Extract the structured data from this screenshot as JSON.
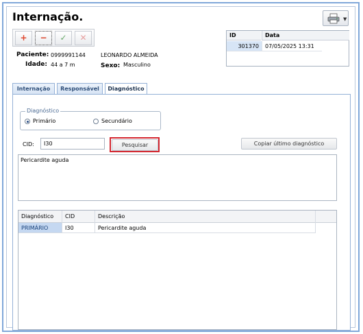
{
  "window": {
    "title": "Internação."
  },
  "toolbar": {
    "add_symbol": "+",
    "remove_symbol": "−",
    "confirm_symbol": "✓",
    "cancel_symbol": "✕"
  },
  "patient": {
    "paciente_label": "Paciente:",
    "paciente_id": "0999991144",
    "paciente_name": "LEONARDO ALMEIDA",
    "idade_label": "Idade:",
    "idade_value": "44 a 7 m",
    "sexo_label": "Sexo:",
    "sexo_value": "Masculino"
  },
  "record_grid": {
    "headers": [
      "ID",
      "Data"
    ],
    "rows": [
      [
        "301370",
        "07/05/2025 13:31"
      ]
    ]
  },
  "tabs": [
    {
      "label": "Internação"
    },
    {
      "label": "Responsável"
    },
    {
      "label": "Diagnóstico",
      "active": true
    }
  ],
  "diagnostico_group": {
    "legend": "Diagnóstico",
    "options": [
      {
        "label": "Primário",
        "selected": true
      },
      {
        "label": "Secundário",
        "selected": false
      }
    ]
  },
  "cid": {
    "label": "CID:",
    "value": "I30"
  },
  "buttons": {
    "pesquisar": "Pesquisar",
    "copiar": "Copiar último diagnóstico"
  },
  "description_text": "Pericardite aguda",
  "diagnosis_table": {
    "headers": [
      "Diagnóstico",
      "CID",
      "Descrição"
    ],
    "rows": [
      [
        "PRIMÁRIO",
        "I30",
        "Pericardite aguda"
      ]
    ]
  },
  "colors": {
    "accent": "#7fa7d9",
    "highlight": "#d3262f",
    "selected_row": "#c5d8f1"
  }
}
